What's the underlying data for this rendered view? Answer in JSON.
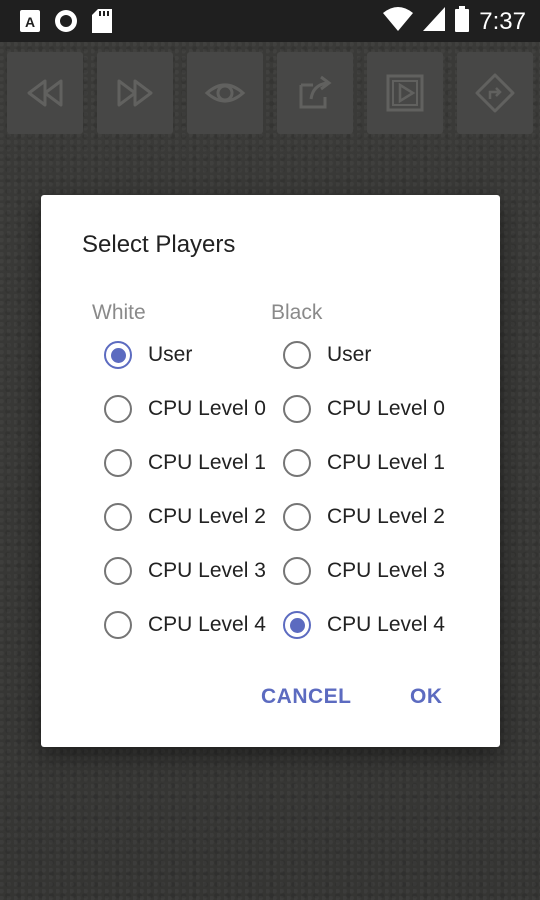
{
  "status_bar": {
    "time": "7:37",
    "left_icons": [
      "a-notification-icon",
      "circle-notification-icon",
      "sd-card-icon"
    ],
    "right_icons": [
      "wifi-icon",
      "signal-icon",
      "battery-icon"
    ]
  },
  "toolbar": {
    "buttons": [
      "rewind-icon",
      "fast-forward-icon",
      "eye-icon",
      "share-icon",
      "play-icon",
      "goto-icon"
    ]
  },
  "dialog": {
    "title": "Select Players",
    "white": {
      "header": "White",
      "options": [
        "User",
        "CPU Level 0",
        "CPU Level 1",
        "CPU Level 2",
        "CPU Level 3",
        "CPU Level 4"
      ],
      "selected": "User"
    },
    "black": {
      "header": "Black",
      "options": [
        "User",
        "CPU Level 0",
        "CPU Level 1",
        "CPU Level 2",
        "CPU Level 3",
        "CPU Level 4"
      ],
      "selected": "CPU Level 4"
    },
    "cancel_label": "CANCEL",
    "ok_label": "OK"
  },
  "colors": {
    "accent": "#5c6bc0",
    "status_bar": "#1f1f1f",
    "background": "#3a3a38",
    "toolbar_button": "#4e4e4c"
  }
}
